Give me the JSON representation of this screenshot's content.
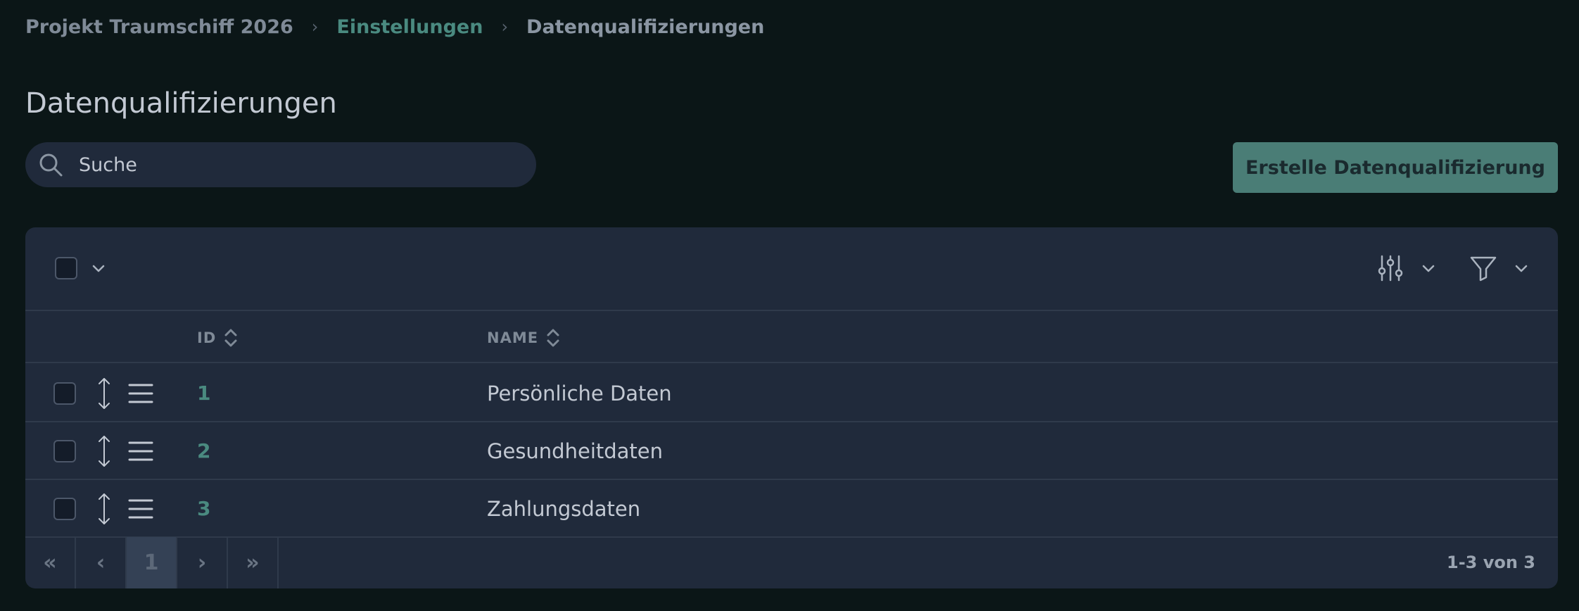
{
  "breadcrumb": {
    "project": "Projekt Traumschiff 2026",
    "settings": "Einstellungen",
    "current": "Datenqualifizierungen",
    "separator": "›"
  },
  "page": {
    "title": "Datenqualifizierungen"
  },
  "search": {
    "placeholder": "Suche"
  },
  "actions": {
    "create_label": "Erstelle Datenqualifizierung"
  },
  "table": {
    "columns": {
      "id": "ID",
      "name": "NAME"
    },
    "rows": [
      {
        "id": "1",
        "name": "Persönliche Daten"
      },
      {
        "id": "2",
        "name": "Gesundheitdaten"
      },
      {
        "id": "3",
        "name": "Zahlungsdaten"
      }
    ]
  },
  "pagination": {
    "first": "«",
    "prev": "‹",
    "current": "1",
    "next": "›",
    "last": "»",
    "info": "1-3 von 3"
  },
  "colors": {
    "background": "#0b1617",
    "panel": "#202a3b",
    "accent": "#4a8a80",
    "button": "#4a7d76"
  }
}
